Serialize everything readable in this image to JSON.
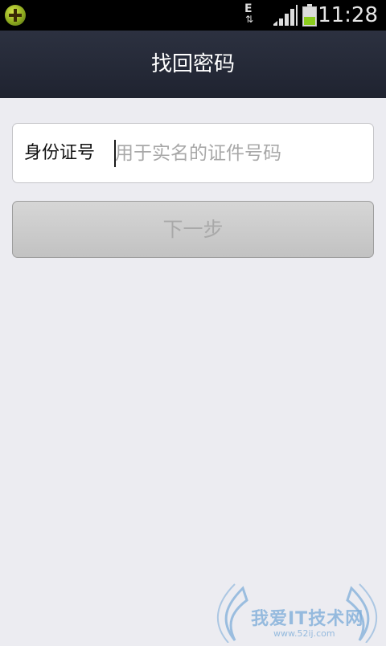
{
  "status_bar": {
    "time": "11:28",
    "network_type": "E",
    "network_activity": "⇅",
    "battery_level": 0.45,
    "signal_level": 4,
    "icons": [
      "app-notification-icon",
      "network-e-icon",
      "signal-icon",
      "battery-icon"
    ]
  },
  "header": {
    "title": "找回密码"
  },
  "form": {
    "id_label": "身份证号",
    "id_placeholder": "用于实名的证件号码",
    "id_value": ""
  },
  "actions": {
    "next_label": "下一步",
    "next_enabled": false
  },
  "watermark": {
    "text": "我爱IT技术网",
    "url": "www.52ij.com"
  },
  "colors": {
    "title_bar": "#232836",
    "page_bg": "#ececf1",
    "button_disabled": "#c8c8c8",
    "battery_fill": "#8ccc1e"
  }
}
